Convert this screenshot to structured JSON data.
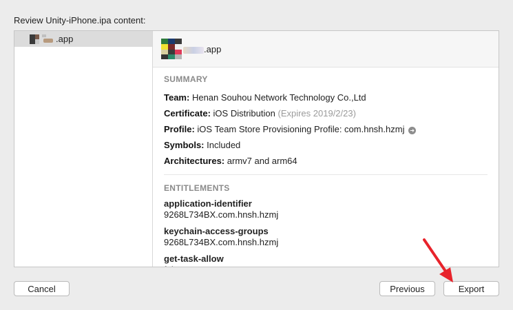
{
  "dialog": {
    "heading": "Review Unity-iPhone.ipa content:"
  },
  "sidebar": {
    "items": [
      {
        "label": ".app"
      }
    ]
  },
  "detail": {
    "header_app_name": ".app",
    "summary": {
      "title": "SUMMARY",
      "team_label": "Team:",
      "team_value": "Henan Souhou Network Technology Co.,Ltd",
      "certificate_label": "Certificate:",
      "certificate_value": "iOS Distribution",
      "certificate_expiry": "(Expires 2019/2/23)",
      "profile_label": "Profile:",
      "profile_value": "iOS Team Store Provisioning Profile: com.hnsh.hzmj",
      "symbols_label": "Symbols:",
      "symbols_value": "Included",
      "architectures_label": "Architectures:",
      "architectures_value": "armv7 and arm64"
    },
    "entitlements": {
      "title": "ENTITLEMENTS",
      "items": [
        {
          "key": "application-identifier",
          "value": "9268L734BX.com.hnsh.hzmj"
        },
        {
          "key": "keychain-access-groups",
          "value": "9268L734BX.com.hnsh.hzmj"
        },
        {
          "key": "get-task-allow",
          "value": "false"
        }
      ]
    }
  },
  "buttons": {
    "cancel": "Cancel",
    "previous": "Previous",
    "export": "Export"
  },
  "colors": {
    "annotation_arrow": "#e8232b",
    "selection": "#dcdcdc"
  }
}
